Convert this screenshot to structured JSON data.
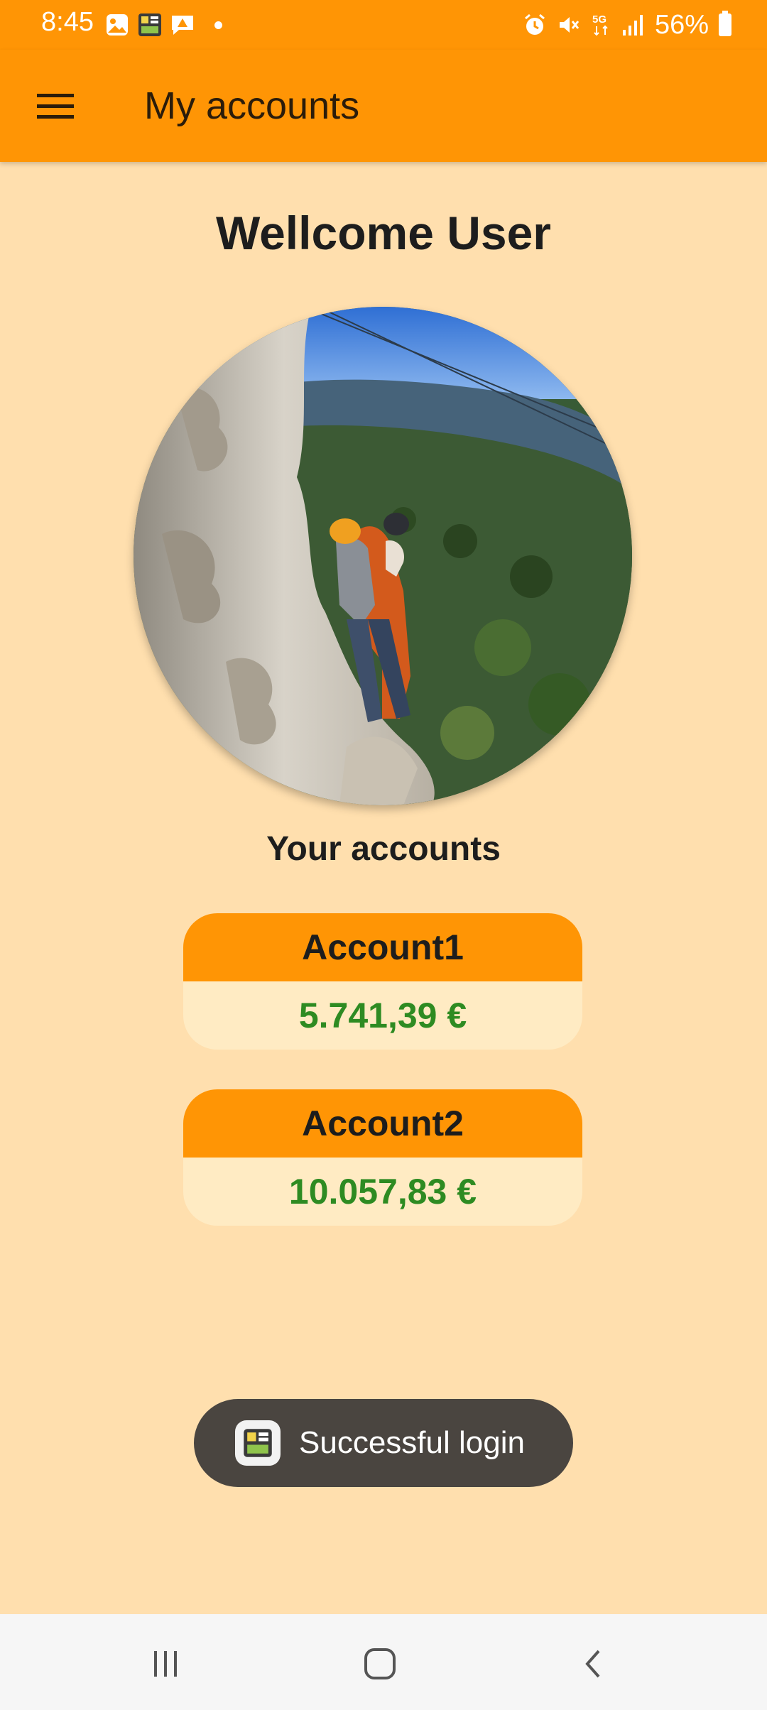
{
  "status_bar": {
    "time": "8:45",
    "battery": "56%",
    "left_icons": [
      "gallery-icon",
      "app-icon",
      "notification-icon"
    ],
    "right_icons": [
      "alarm-icon",
      "mute-icon",
      "5g-icon",
      "signal-icon",
      "battery-icon"
    ]
  },
  "app_bar": {
    "title": "My accounts",
    "menu_icon": "hamburger-menu-icon"
  },
  "main": {
    "welcome": "Wellcome User",
    "accounts_heading": "Your accounts",
    "accounts": [
      {
        "name": "Account1",
        "balance": "5.741,39 €"
      },
      {
        "name": "Account2",
        "balance": "10.057,83 €"
      }
    ]
  },
  "toast": {
    "text": "Successful login"
  },
  "nav_bar": {
    "buttons": [
      "recents-icon",
      "home-icon",
      "back-icon"
    ]
  },
  "colors": {
    "primary": "#FF9505",
    "background": "#FFDFAE",
    "card_body": "#FFEBC3",
    "balance_green": "#2E8B22",
    "toast_bg": "#4A4540"
  }
}
